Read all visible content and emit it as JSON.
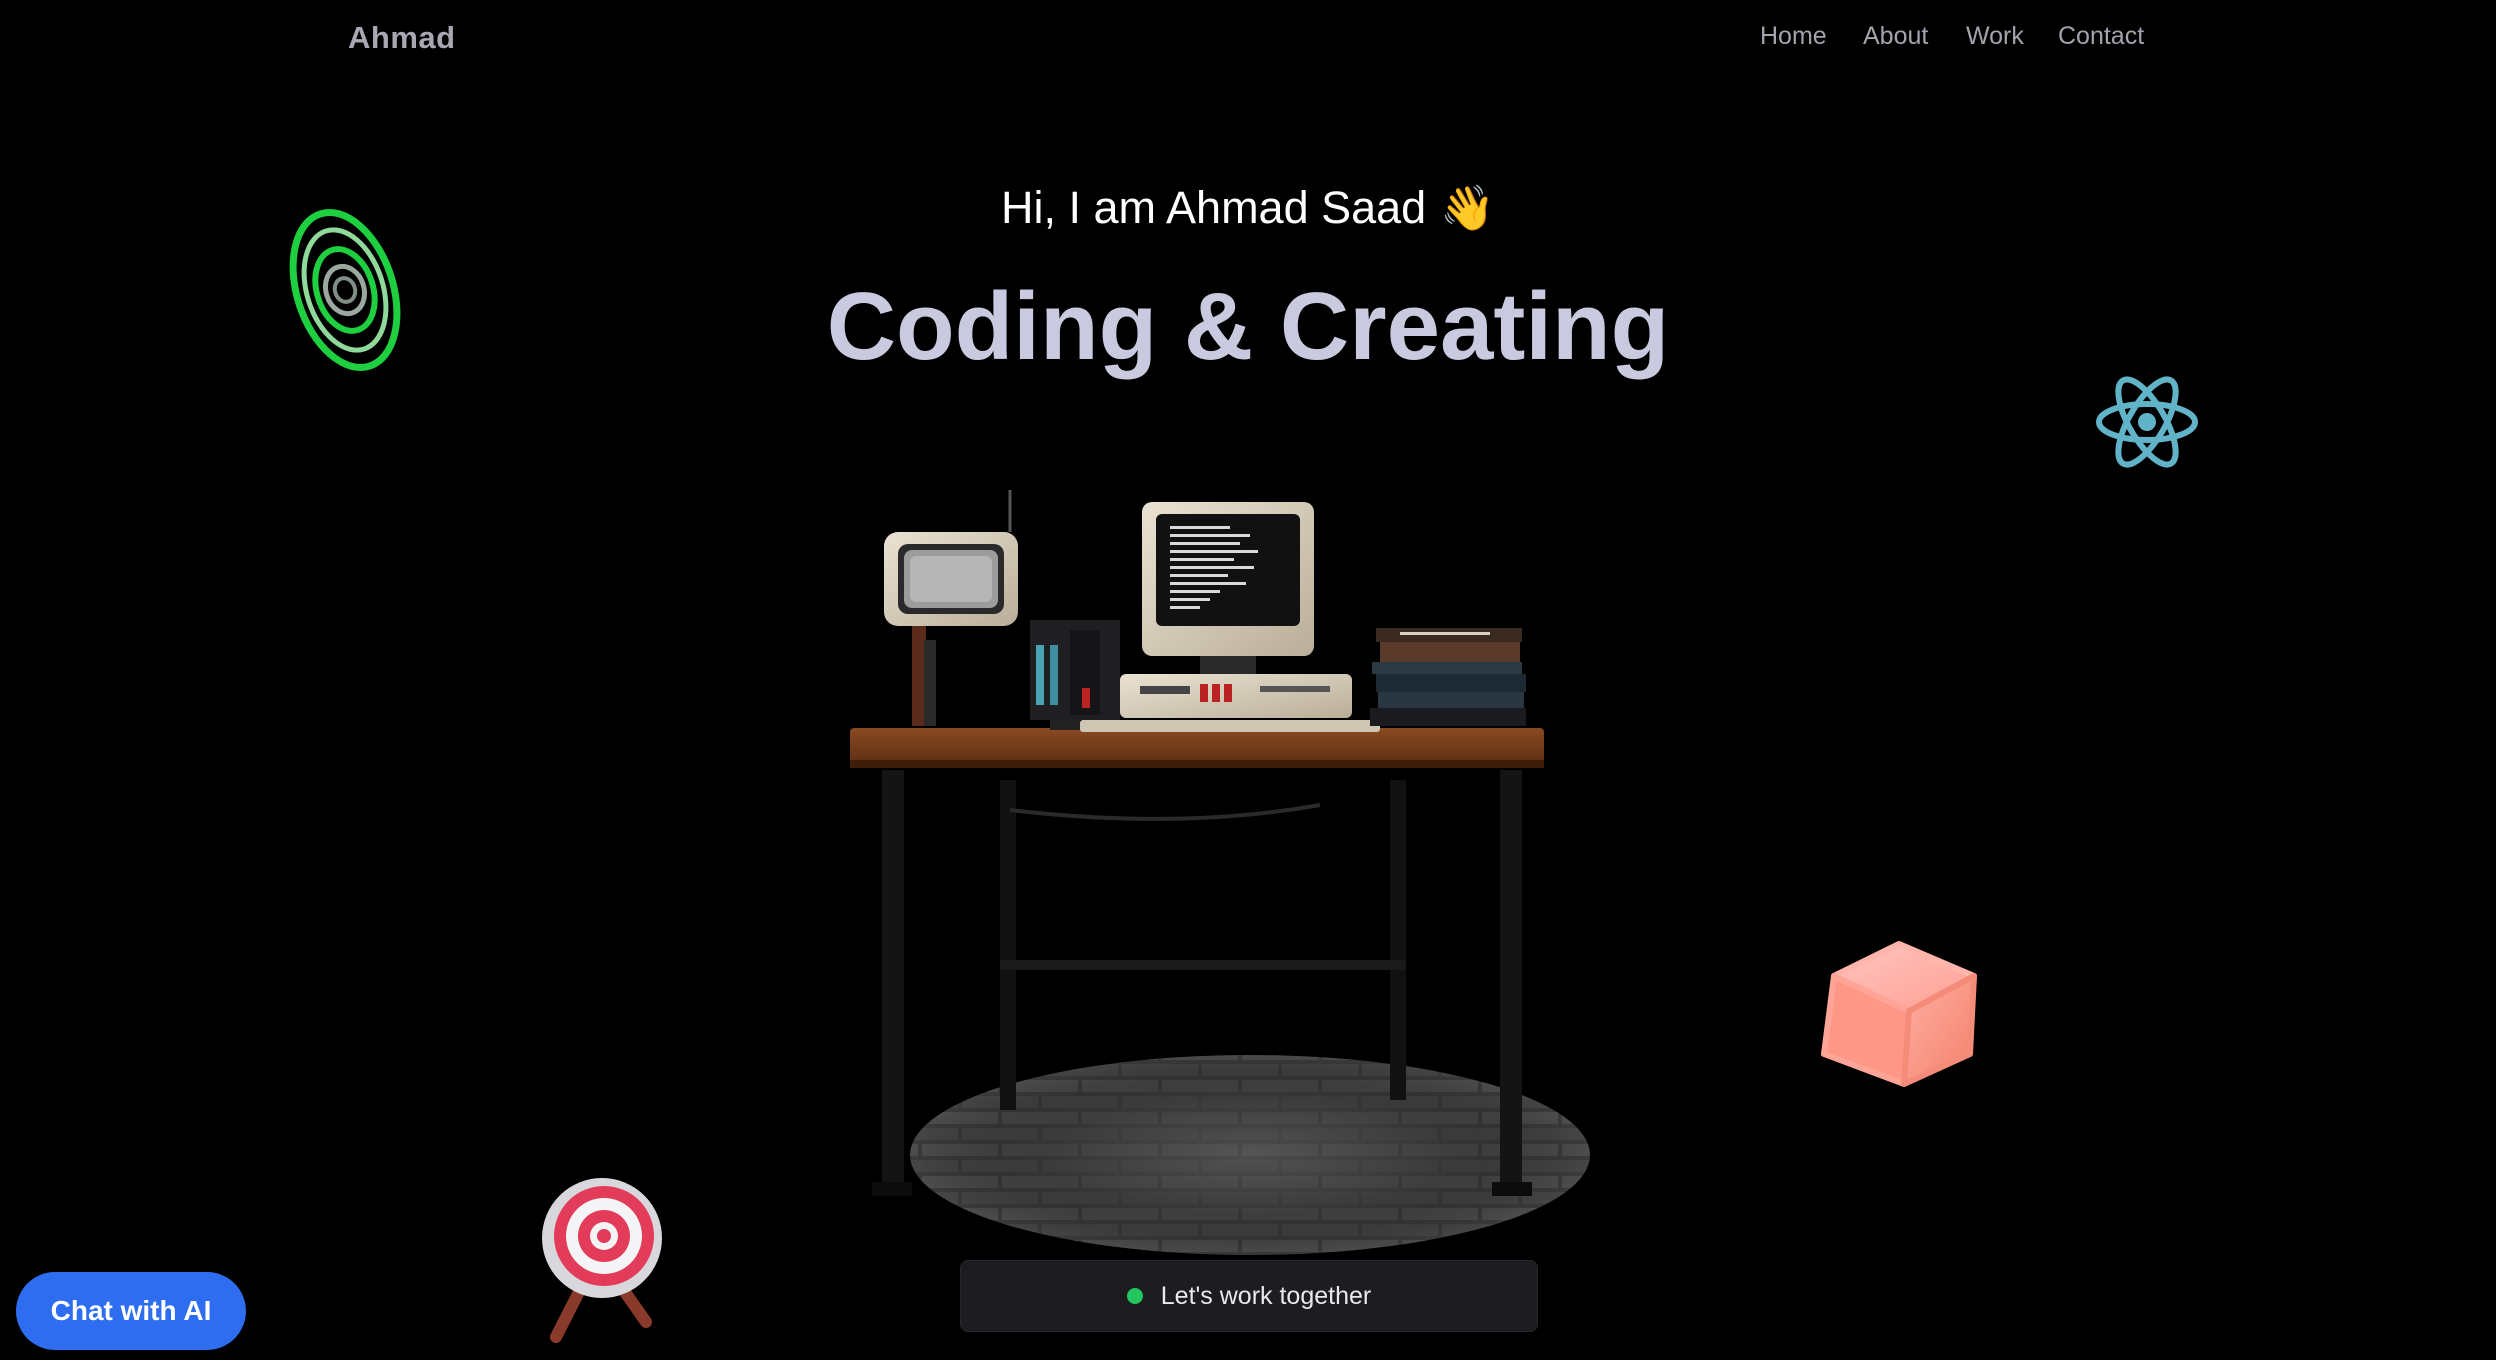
{
  "header": {
    "brand": "Ahmad",
    "nav": [
      {
        "label": "Home"
      },
      {
        "label": "About"
      },
      {
        "label": "Work"
      },
      {
        "label": "Contact"
      }
    ]
  },
  "hero": {
    "greeting": "Hi, I am Ahmad Saad",
    "wave_emoji": "👋",
    "headline": "Coding & Creating"
  },
  "decorations": {
    "rings_icon": "green-rings-icon",
    "react_icon": "react-logo-icon",
    "cube_icon": "pink-cube-icon",
    "target_icon": "target-icon",
    "scene": "retro-computer-desk-scene"
  },
  "cta": {
    "label": "Let's work together",
    "status_color": "#22c55e"
  },
  "chat": {
    "label": "Chat with AI",
    "color": "#2f6df0"
  },
  "colors": {
    "background": "#000000",
    "headline": "#c9cadf",
    "react": "#61b3c8"
  }
}
